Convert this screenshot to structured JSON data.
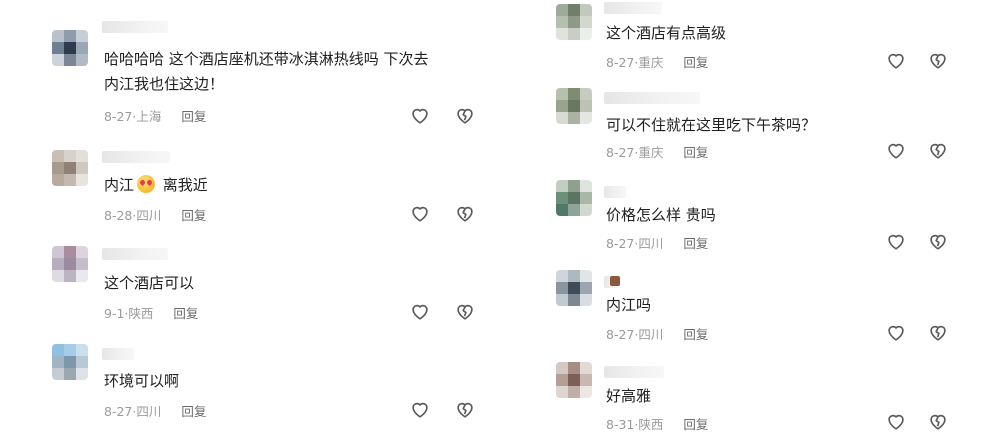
{
  "left": [
    {
      "text": "哈哈哈哈 这个酒店座机还带冰淇淋热线吗 下次去\n内江我也住这边！",
      "date": "8-27",
      "location": "上海",
      "reply": "回复"
    },
    {
      "text_before": "内江",
      "emoji": "heart-eyes-emoji",
      "text_after": " 离我近",
      "date": "8-28",
      "location": "四川",
      "reply": "回复"
    },
    {
      "text": "这个酒店可以",
      "date": "9-1",
      "location": "陕西",
      "reply": "回复"
    },
    {
      "text": "环境可以啊",
      "date": "8-27",
      "location": "四川",
      "reply": "回复"
    }
  ],
  "right": [
    {
      "text": "这个酒店有点高级",
      "date": "8-27",
      "location": "重庆",
      "reply": "回复"
    },
    {
      "text": "可以不住就在这里吃下午茶吗？",
      "date": "8-27",
      "location": "重庆",
      "reply": "回复"
    },
    {
      "text": "价格怎么样 贵吗",
      "date": "8-27",
      "location": "四川",
      "reply": "回复"
    },
    {
      "text": "内江吗",
      "date": "8-27",
      "location": "四川",
      "reply": "回复"
    },
    {
      "text": "好高雅",
      "date": "8-31",
      "location": "陕西",
      "reply": "回复"
    }
  ],
  "meta_separator": "·",
  "icons": {
    "like": "heart-outline-icon",
    "dislike": "broken-heart-icon"
  },
  "colors": {
    "text": "#202020",
    "meta": "#9a9a9a",
    "reply": "#6a6a6a",
    "icon": "#5a5a5a"
  }
}
